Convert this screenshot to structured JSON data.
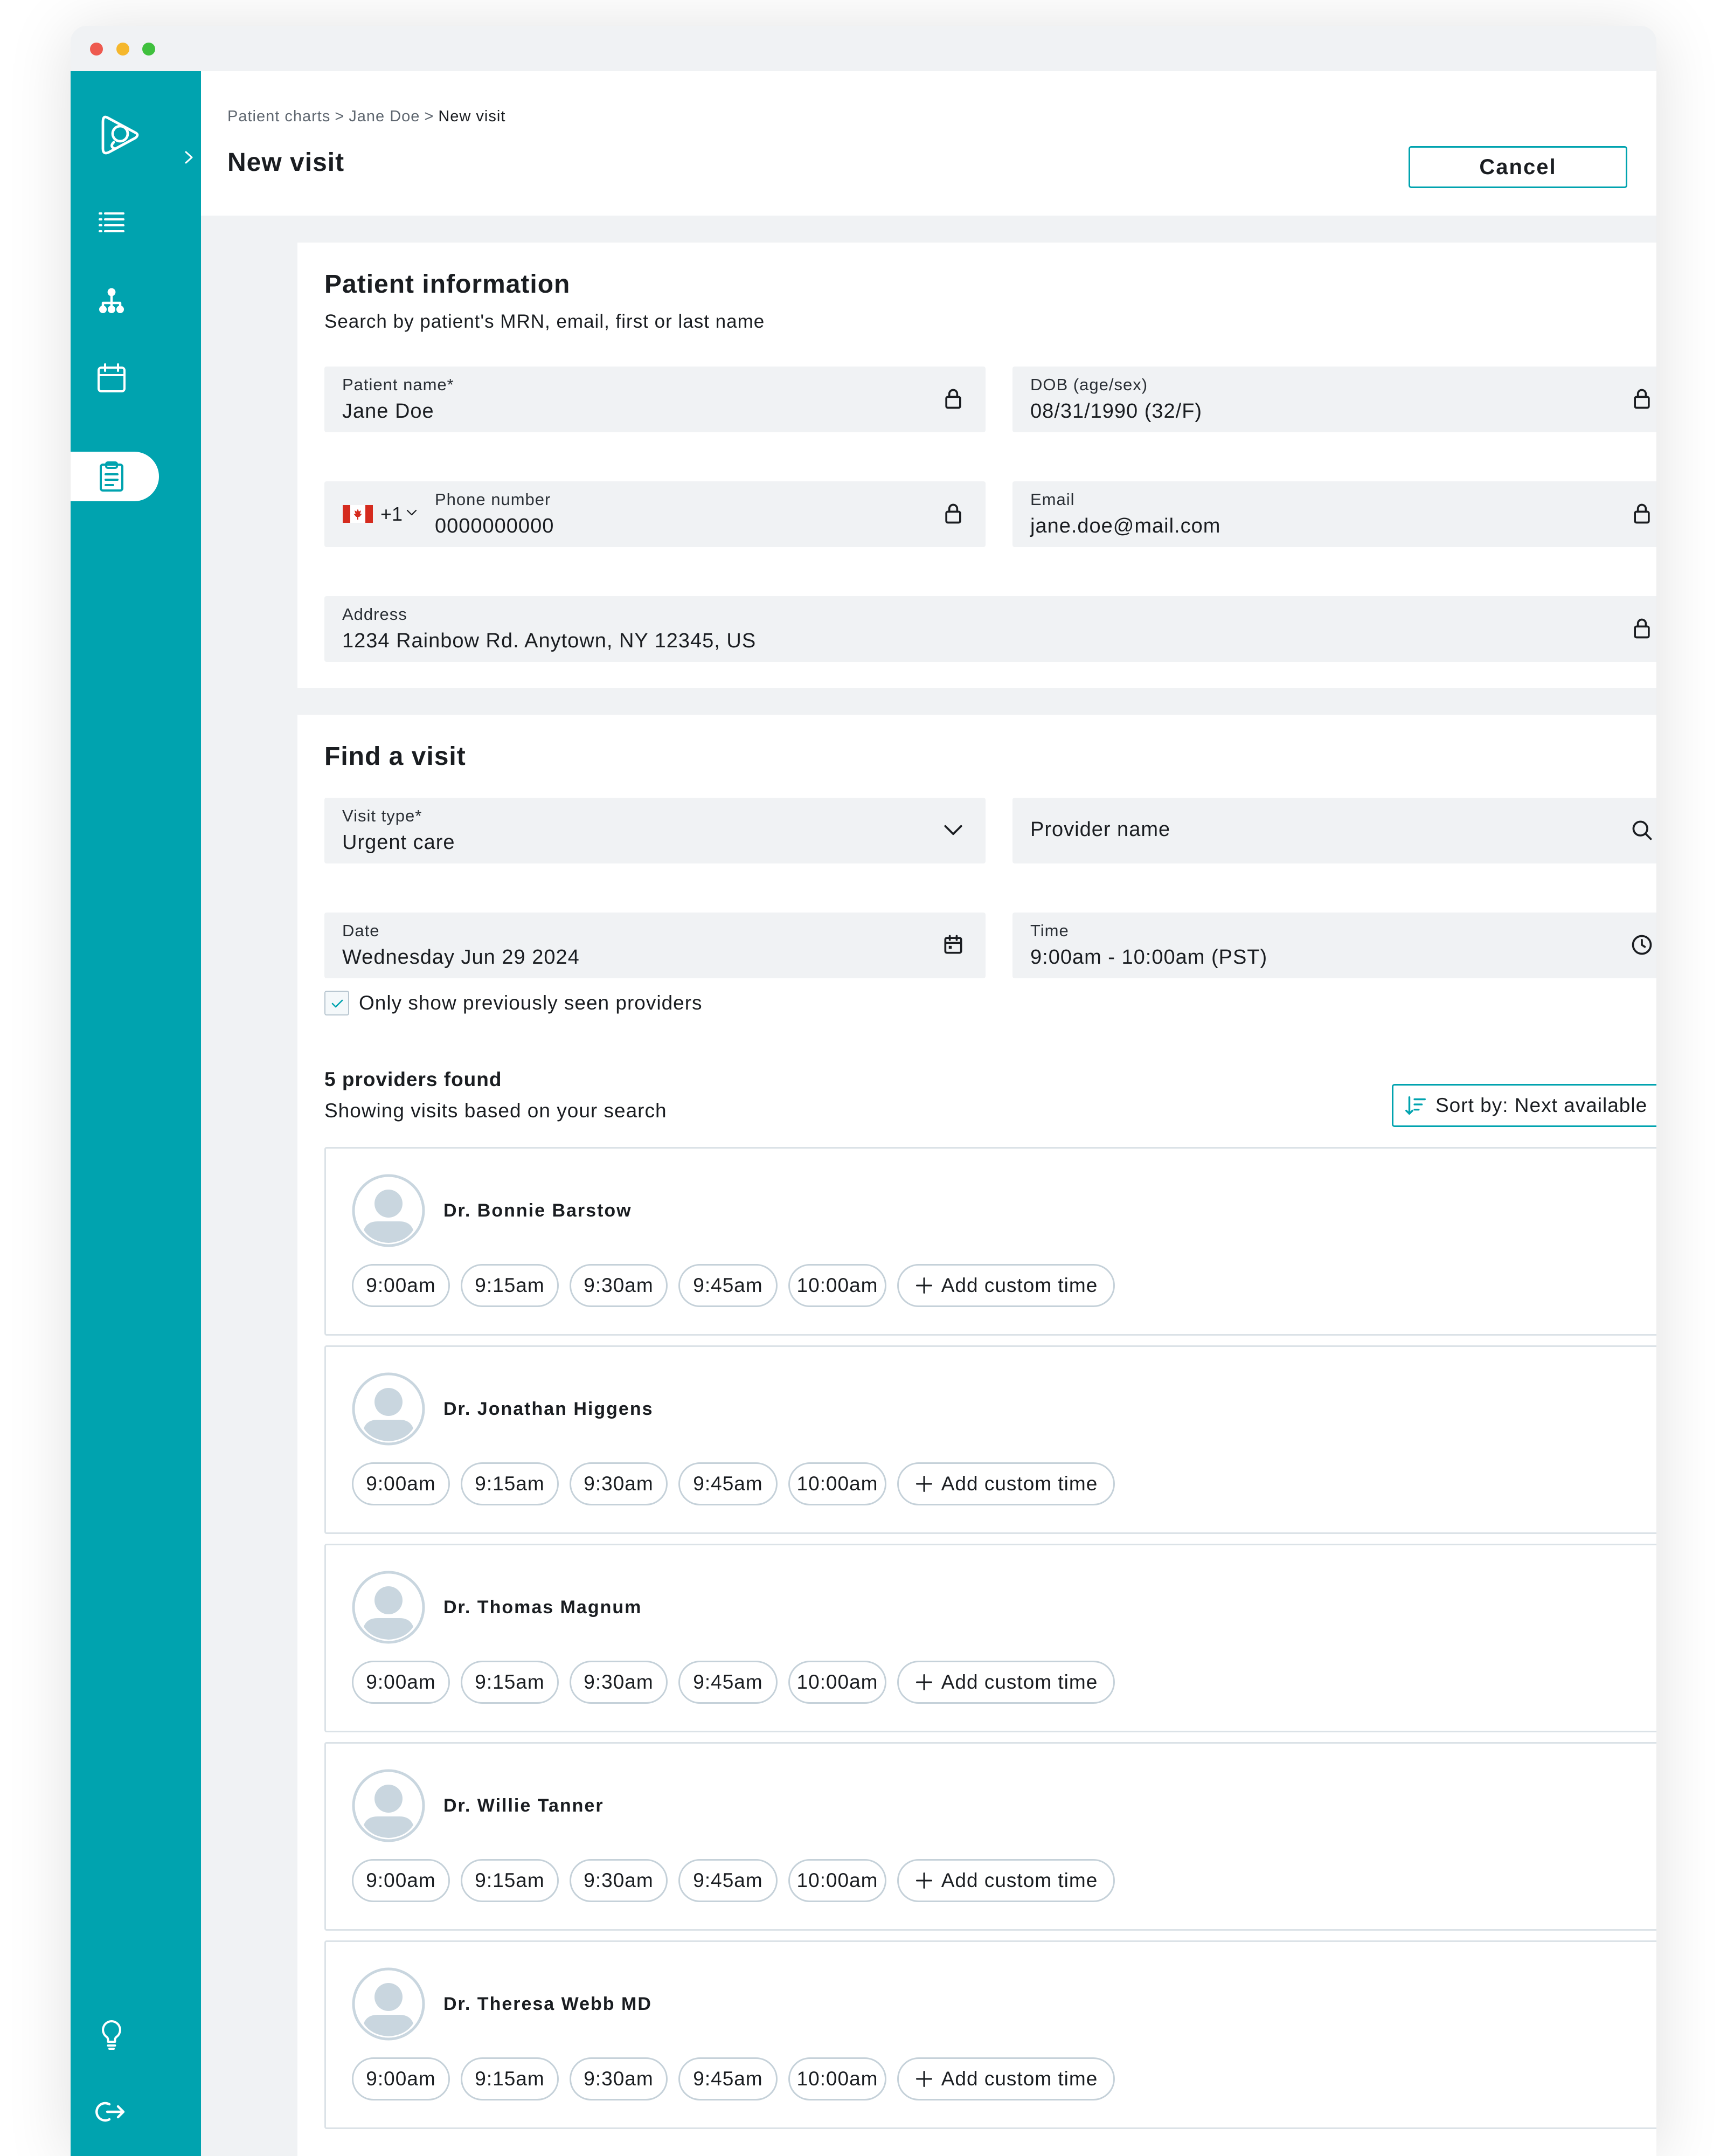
{
  "breadcrumb": [
    "Patient charts",
    "Jane Doe",
    "New visit"
  ],
  "breadcrumb_separator": ">",
  "page_title": "New visit",
  "cancel_label": "Cancel",
  "sidebar": {
    "logo_icon": "app-logo-icon",
    "expand_icon": "chevron-right-icon",
    "items": [
      {
        "icon": "list-icon"
      },
      {
        "icon": "org-chart-icon"
      },
      {
        "icon": "calendar-icon"
      },
      {
        "icon": "clipboard-icon",
        "active": true
      }
    ],
    "bottom_items": [
      {
        "icon": "lightbulb-icon"
      },
      {
        "icon": "logout-icon"
      }
    ]
  },
  "patient": {
    "title": "Patient information",
    "subtitle": "Search by patient's MRN, email, first or last name",
    "name_label": "Patient name*",
    "name_value": "Jane Doe",
    "dob_label": "DOB (age/sex)",
    "dob_value": "08/31/1990 (32/F)",
    "country_code": "+1",
    "phone_label": "Phone number",
    "phone_value": "0000000000",
    "email_label": "Email",
    "email_value": "jane.doe@mail.com",
    "address_label": "Address",
    "address_value": "1234 Rainbow Rd. Anytown, NY 12345, US"
  },
  "visit": {
    "title": "Find a visit",
    "type_label": "Visit type*",
    "type_value": "Urgent care",
    "provider_placeholder": "Provider name",
    "date_label": "Date",
    "date_value": "Wednesday Jun 29 2024",
    "time_label": "Time",
    "time_value": "9:00am - 10:00am (PST)",
    "checkbox_label": "Only show previously seen providers",
    "checkbox_checked": true,
    "found_text": "5 providers found",
    "showing_text": "Showing visits based on your search",
    "sort_label": "Sort by: Next available"
  },
  "providers": [
    {
      "name": "Dr. Bonnie Barstow",
      "times": [
        "9:00am",
        "9:15am",
        "9:30am",
        "9:45am",
        "10:00am"
      ],
      "custom": "Add custom time"
    },
    {
      "name": "Dr. Jonathan Higgens",
      "times": [
        "9:00am",
        "9:15am",
        "9:30am",
        "9:45am",
        "10:00am"
      ],
      "custom": "Add custom time"
    },
    {
      "name": "Dr. Thomas Magnum",
      "times": [
        "9:00am",
        "9:15am",
        "9:30am",
        "9:45am",
        "10:00am"
      ],
      "custom": "Add custom time"
    },
    {
      "name": "Dr. Willie Tanner",
      "times": [
        "9:00am",
        "9:15am",
        "9:30am",
        "9:45am",
        "10:00am"
      ],
      "custom": "Add custom time"
    },
    {
      "name": "Dr. Theresa Webb MD",
      "times": [
        "9:00am",
        "9:15am",
        "9:30am",
        "9:45am",
        "10:00am"
      ],
      "custom": "Add custom time"
    }
  ],
  "colors": {
    "accent": "#00a3af",
    "field_bg": "#f0f2f4",
    "page_bg": "#f0f2f4",
    "card_bg": "#ffffff",
    "border": "#dbe2e7"
  }
}
